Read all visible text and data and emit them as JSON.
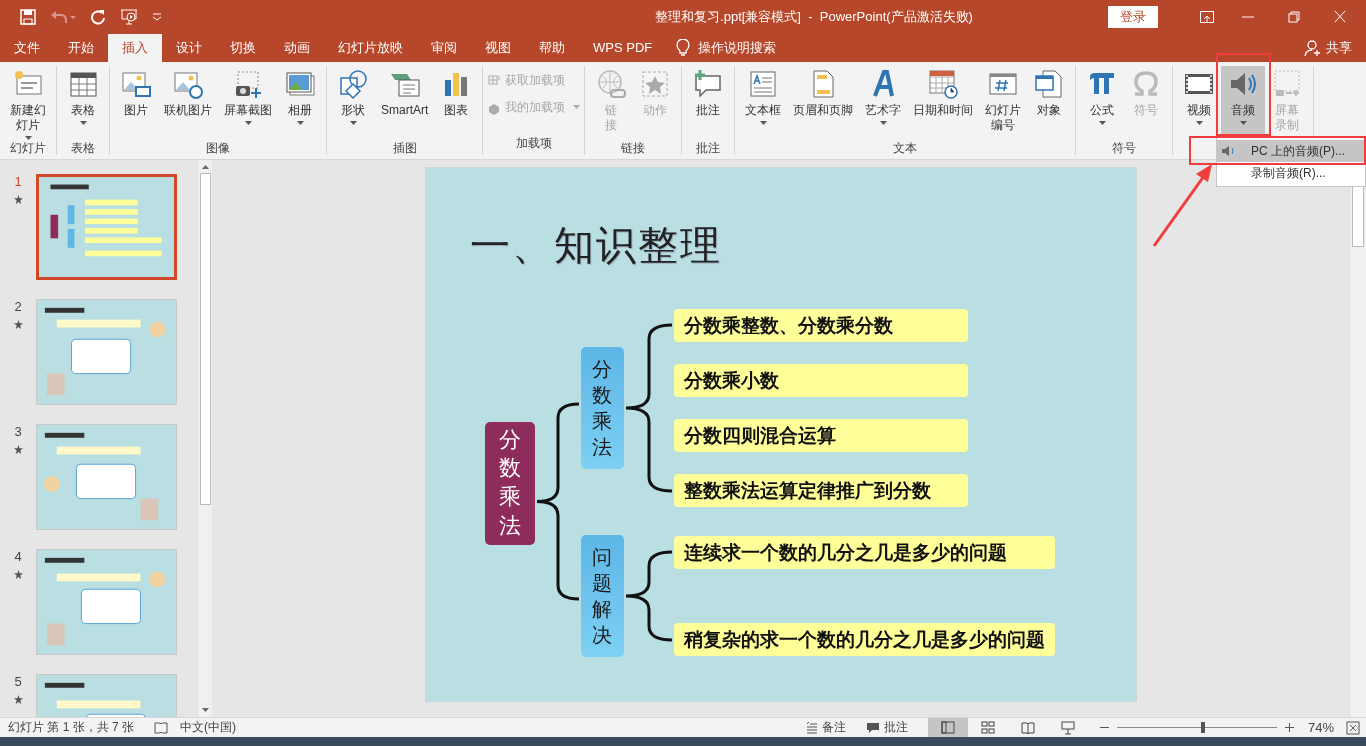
{
  "window": {
    "title": "整理和复习.ppt[兼容模式]  -  PowerPoint(产品激活失败)",
    "login_button": "登录"
  },
  "tabs": [
    {
      "label": "文件",
      "selected": false
    },
    {
      "label": "开始",
      "selected": false
    },
    {
      "label": "插入",
      "selected": true
    },
    {
      "label": "设计",
      "selected": false
    },
    {
      "label": "切换",
      "selected": false
    },
    {
      "label": "动画",
      "selected": false
    },
    {
      "label": "幻灯片放映",
      "selected": false
    },
    {
      "label": "审阅",
      "selected": false
    },
    {
      "label": "视图",
      "selected": false
    },
    {
      "label": "帮助",
      "selected": false
    },
    {
      "label": "WPS PDF",
      "selected": false
    }
  ],
  "tell_me": "操作说明搜索",
  "share": "共享",
  "ribbon_groups": [
    {
      "label": "幻灯片",
      "items": [
        {
          "label": "新建幻灯片",
          "multiline": true,
          "kind": "large",
          "disabled": false,
          "dropdown": true,
          "pressed": false
        }
      ]
    },
    {
      "label": "表格",
      "items": [
        {
          "label": "表格",
          "kind": "large",
          "disabled": false,
          "dropdown": true,
          "pressed": false
        }
      ]
    },
    {
      "label": "图像",
      "items": [
        {
          "label": "图片",
          "kind": "large",
          "disabled": false,
          "dropdown": false,
          "pressed": false
        },
        {
          "label": "联机图片",
          "kind": "large",
          "disabled": false,
          "dropdown": false,
          "pressed": false
        },
        {
          "label": "屏幕截图",
          "kind": "large",
          "disabled": false,
          "dropdown": true,
          "pressed": false
        },
        {
          "label": "相册",
          "kind": "large",
          "disabled": false,
          "dropdown": true,
          "pressed": false
        }
      ]
    },
    {
      "label": "插图",
      "items": [
        {
          "label": "形状",
          "kind": "large",
          "disabled": false,
          "dropdown": true,
          "pressed": false
        },
        {
          "label": "SmartArt",
          "kind": "large",
          "disabled": false,
          "dropdown": false,
          "pressed": false
        },
        {
          "label": "图表",
          "kind": "large",
          "disabled": false,
          "dropdown": false,
          "pressed": false
        }
      ]
    },
    {
      "label": "加载项",
      "items": [
        {
          "label": "获取加载项",
          "kind": "small",
          "disabled": true,
          "dropdown": false,
          "pressed": false
        },
        {
          "label": "我的加载项",
          "kind": "small",
          "disabled": true,
          "dropdown": true,
          "pressed": false
        }
      ]
    },
    {
      "label": "链接",
      "items": [
        {
          "label": "链接",
          "multiline": true,
          "kind": "large",
          "disabled": true,
          "dropdown": false,
          "pressed": false
        },
        {
          "label": "动作",
          "kind": "large",
          "disabled": true,
          "dropdown": false,
          "pressed": false
        }
      ]
    },
    {
      "label": "批注",
      "items": [
        {
          "label": "批注",
          "kind": "large",
          "disabled": false,
          "dropdown": false,
          "pressed": false
        }
      ]
    },
    {
      "label": "文本",
      "items": [
        {
          "label": "文本框",
          "kind": "large",
          "disabled": false,
          "dropdown": true,
          "pressed": false
        },
        {
          "label": "页眉和页脚",
          "kind": "large",
          "disabled": false,
          "dropdown": false,
          "pressed": false
        },
        {
          "label": "艺术字",
          "kind": "large",
          "disabled": false,
          "dropdown": true,
          "pressed": false
        },
        {
          "label": "日期和时间",
          "kind": "large",
          "disabled": false,
          "dropdown": false,
          "pressed": false
        },
        {
          "label": "幻灯片编号",
          "multiline": true,
          "kind": "large",
          "disabled": false,
          "dropdown": false,
          "pressed": false
        },
        {
          "label": "对象",
          "kind": "large",
          "disabled": false,
          "dropdown": false,
          "pressed": false
        }
      ]
    },
    {
      "label": "符号",
      "items": [
        {
          "label": "公式",
          "kind": "large",
          "disabled": false,
          "dropdown": true,
          "pressed": false
        },
        {
          "label": "符号",
          "kind": "large",
          "disabled": true,
          "dropdown": false,
          "pressed": false
        }
      ]
    },
    {
      "items": [
        {
          "label": "视频",
          "kind": "large",
          "disabled": false,
          "dropdown": true,
          "pressed": false
        },
        {
          "label": "音频",
          "kind": "large",
          "disabled": false,
          "dropdown": true,
          "pressed": true
        },
        {
          "label": "屏幕录制",
          "multiline": true,
          "kind": "large",
          "disabled": true,
          "dropdown": false,
          "pressed": false
        }
      ]
    }
  ],
  "audio_menu": {
    "items": [
      {
        "label": "PC 上的音频(P)...",
        "selected": true
      },
      {
        "label": "录制音频(R)...",
        "selected": false
      }
    ]
  },
  "thumbnails": [
    {
      "number": "1",
      "selected": true,
      "has_animation": true
    },
    {
      "number": "2",
      "selected": false,
      "has_animation": true
    },
    {
      "number": "3",
      "selected": false,
      "has_animation": true
    },
    {
      "number": "4",
      "selected": false,
      "has_animation": true
    },
    {
      "number": "5",
      "selected": false,
      "has_animation": true
    }
  ],
  "slide": {
    "title": "一、知识整理",
    "center": "分数乘法",
    "branches": [
      {
        "label": "分数乘法",
        "items": [
          "分数乘整数、分数乘分数",
          "分数乘小数",
          "分数四则混合运算",
          "整数乘法运算定律推广到分数"
        ]
      },
      {
        "label": "问题解决",
        "items": [
          "连续求一个数的几分之几是多少的问题",
          "稍复杂的求一个数的几分之几是多少的问题"
        ]
      }
    ]
  },
  "status_bar": {
    "slide_info": "幻灯片 第 1 张，共 7 张",
    "language": "中文(中国)",
    "notes": "备注",
    "comments": "批注",
    "views": [
      {
        "selected": true
      },
      {
        "selected": false
      },
      {
        "selected": false
      },
      {
        "selected": false
      }
    ],
    "zoom": {
      "level": 0.54
    },
    "zoom_text": "74%"
  }
}
